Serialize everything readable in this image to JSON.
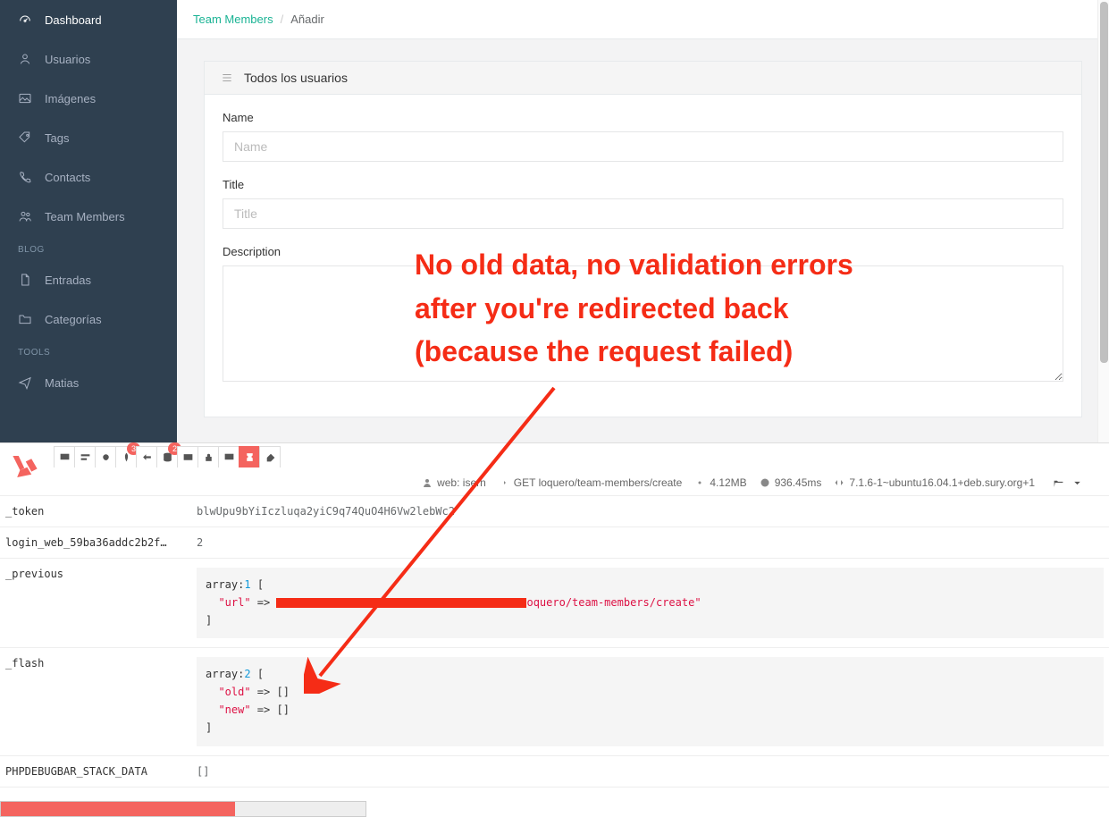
{
  "sidebar": {
    "items": [
      {
        "label": "Dashboard",
        "icon": "gauge-icon"
      },
      {
        "label": "Usuarios",
        "icon": "user-icon"
      },
      {
        "label": "Imágenes",
        "icon": "image-icon"
      },
      {
        "label": "Tags",
        "icon": "tag-icon"
      },
      {
        "label": "Contacts",
        "icon": "phone-icon"
      },
      {
        "label": "Team Members",
        "icon": "users-icon"
      }
    ],
    "headings": {
      "blog": "BLOG",
      "tools": "TOOLS"
    },
    "blog_items": [
      {
        "label": "Entradas",
        "icon": "file-icon"
      },
      {
        "label": "Categorías",
        "icon": "folder-icon"
      }
    ],
    "tools_items": [
      {
        "label": "Matias",
        "icon": "send-icon"
      }
    ]
  },
  "breadcrumb": {
    "parent": "Team Members",
    "current": "Añadir"
  },
  "panel": {
    "title": "Todos los usuarios",
    "fields": {
      "name": {
        "label": "Name",
        "placeholder": "Name"
      },
      "title": {
        "label": "Title",
        "placeholder": "Title"
      },
      "description": {
        "label": "Description"
      }
    }
  },
  "annotation": {
    "line1": "No old data, no validation errors",
    "line2": "after you're redirected back",
    "line3": "(because the request failed)"
  },
  "debugbar": {
    "tabs": {
      "leaf_badge": "3",
      "db_badge": "2"
    },
    "status": {
      "user": "web: isern",
      "request": "GET loquero/team-members/create",
      "memory": "4.12MB",
      "time": "936.45ms",
      "php": "7.1.6-1~ubuntu16.04.1+deb.sury.org+1"
    },
    "session": {
      "token_key": "_token",
      "token_val": "blwUpu9bYiIczluqa2yiC9q74QuO4H6Vw2lebWc2",
      "login_key": "login_web_59ba36addc2b2f…",
      "login_val": "2",
      "previous_key": "_previous",
      "previous_arr": "array:",
      "previous_count": "1",
      "previous_urlkey": "\"url\"",
      "previous_urlval": "oquero/team-members/create\"",
      "flash_key": "_flash",
      "flash_arr": "array:",
      "flash_count": "2",
      "flash_old": "\"old\"",
      "flash_new": "\"new\"",
      "stack_key": "PHPDEBUGBAR_STACK_DATA",
      "stack_val": "[]"
    }
  }
}
